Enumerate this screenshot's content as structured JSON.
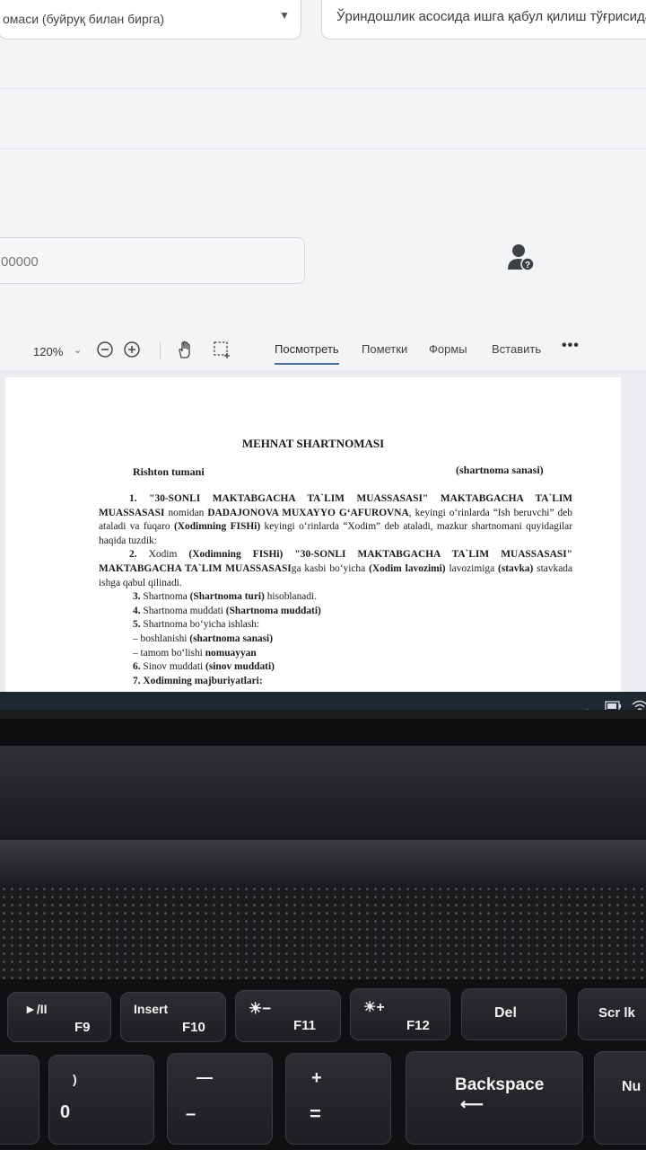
{
  "form": {
    "order_select_value": "омаси (буйруқ билан бирга)",
    "reason_value": "Ўриндошлик асосида ишга қабул қилиш тўғрисида",
    "number_value": "00000"
  },
  "toolbar": {
    "zoom": "120%",
    "tabs": [
      "Посмотреть",
      "Пометки",
      "Формы",
      "Вставить"
    ],
    "more": "•••"
  },
  "document": {
    "title": "MEHNAT SHARTNOMASI",
    "place": "Rishton tumani",
    "date": "(shartnoma sanasi)",
    "p1": {
      "n": "1.",
      "org": "\"30-SONLI MAKTABGACHA TA`LIM MUASSASASI\"",
      "org2": "MAKTABGACHA TA`LIM MUASSASASI",
      "t1": "nomidan",
      "director": "DADAJONOVA MUXAYYO G‘AFUROVNA",
      "t2": ", keyingi o‘rinlarda “Ish beruvchi” deb ataladi va fuqaro",
      "employee": "(Xodimning FISHi)",
      "t3": "keyingi o‘rinlarda “Xodim” deb ataladi, mazkur shartnomani quyidagilar haqida tuzdik:"
    },
    "p2": {
      "n": "2.",
      "t1": "Xodim",
      "employee": "(Xodimning FISHi)",
      "org": "\"30-SONLI MAKTABGACHA TA`LIM MUASSASASI\" MAKTABGACHA TA`LIM MUASSASASI",
      "t2": "ga kasbi bo‘yicha",
      "position": "(Xodim lavozimi)",
      "t3": "lavozimiga",
      "rate": "(stavka)",
      "t4": "stavkada ishga qabul qilinadi."
    },
    "p3": {
      "n": "3.",
      "t1": "Shartnoma",
      "v": "(Shartnoma turi)",
      "t2": "hisoblanadi."
    },
    "p4": {
      "n": "4.",
      "t1": "Shartnoma muddati",
      "v": "(Shartnoma muddati)"
    },
    "p5": {
      "n": "5.",
      "t1": "Shartnoma bo‘yicha ishlash:"
    },
    "p5a": {
      "t1": "– boshlanishi",
      "v": "(shartnoma sanasi)"
    },
    "p5b": {
      "t1": "– tamom bo‘lishi",
      "v": "nomuayyan"
    },
    "p6": {
      "n": "6.",
      "t1": "Sinov muddati",
      "v": "(sinov muddati)"
    },
    "p7": {
      "n": "7.",
      "v": "Xodimning majburiyatlari:"
    }
  },
  "keyboard": {
    "f9": {
      "top": "►/II",
      "bottom": "F9"
    },
    "f10": {
      "top": "Insert",
      "bottom": "F10"
    },
    "f11": {
      "top": "☀−",
      "bottom": "F11"
    },
    "f12": {
      "top": "☀+",
      "bottom": "F12"
    },
    "del": "Del",
    "scrlk": "Scr lk",
    "zero": {
      "top": ")",
      "bottom": "0"
    },
    "minus": {
      "top": "—",
      "bottom": "–"
    },
    "equals": {
      "top": "+",
      "bottom": "="
    },
    "backspace": "Backspace",
    "numlk": "Nu"
  },
  "icons": [
    "chevron-down-icon",
    "zoom-out-icon",
    "zoom-in-icon",
    "hand-tool-icon",
    "select-area-icon",
    "user-question-icon",
    "chevron-up-icon",
    "battery-icon",
    "wifi-icon"
  ]
}
